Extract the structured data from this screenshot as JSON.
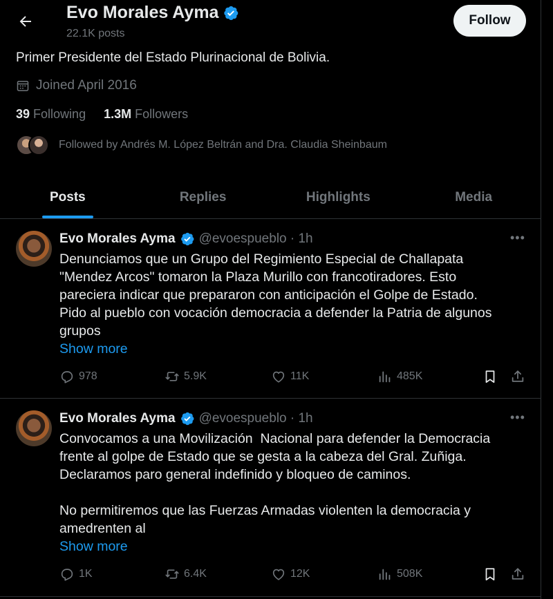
{
  "header": {
    "name": "Evo Morales Ayma",
    "posts": "22.1K posts",
    "follow_label": "Follow"
  },
  "profile": {
    "bio": "Primer Presidente del Estado Plurinacional de Bolivia.",
    "joined": "Joined April 2016",
    "following_count": "39",
    "following_label": "Following",
    "followers_count": "1.3M",
    "followers_label": "Followers",
    "followed_by": "Followed by Andrés M. López Beltrán and Dra. Claudia Sheinbaum"
  },
  "tabs": [
    {
      "label": "Posts",
      "active": true
    },
    {
      "label": "Replies",
      "active": false
    },
    {
      "label": "Highlights",
      "active": false
    },
    {
      "label": "Media",
      "active": false
    }
  ],
  "tweets": [
    {
      "name": "Evo Morales Ayma",
      "handle_time": "@evoespueblo · 1h",
      "text": "Denunciamos que un Grupo del Regimiento Especial de Challapata\n\"Mendez Arcos\" tomaron la Plaza Murillo con francotiradores. Esto\npareciera indicar que prepararon con anticipación el Golpe de Estado.\nPido al pueblo con vocación democracia a defender la Patria de algunos\ngrupos",
      "show_more": "Show more",
      "replies": "978",
      "reposts": "5.9K",
      "likes": "11K",
      "views": "485K"
    },
    {
      "name": "Evo Morales Ayma",
      "handle_time": "@evoespueblo · 1h",
      "text": "Convocamos a una Movilización  Nacional para defender la Democracia\nfrente al golpe de Estado que se gesta a la cabeza del Gral. Zuñiga.\nDeclaramos paro general indefinido y bloqueo de caminos.\n\nNo permitiremos que las Fuerzas Armadas violenten la democracia y\namedrenten al",
      "show_more": "Show more",
      "replies": "1K",
      "reposts": "6.4K",
      "likes": "12K",
      "views": "508K"
    }
  ],
  "icons": {
    "back": "arrow-left-icon",
    "verified": "verified-badge-icon",
    "calendar": "calendar-icon",
    "more": "more-icon",
    "reply": "reply-icon",
    "repost": "repost-icon",
    "like": "heart-icon",
    "views": "views-icon",
    "bookmark": "bookmark-icon",
    "share": "share-icon"
  },
  "colors": {
    "accent": "#1d9bf0",
    "background": "#000000",
    "muted": "#71767b",
    "text": "#e7e9ea"
  }
}
